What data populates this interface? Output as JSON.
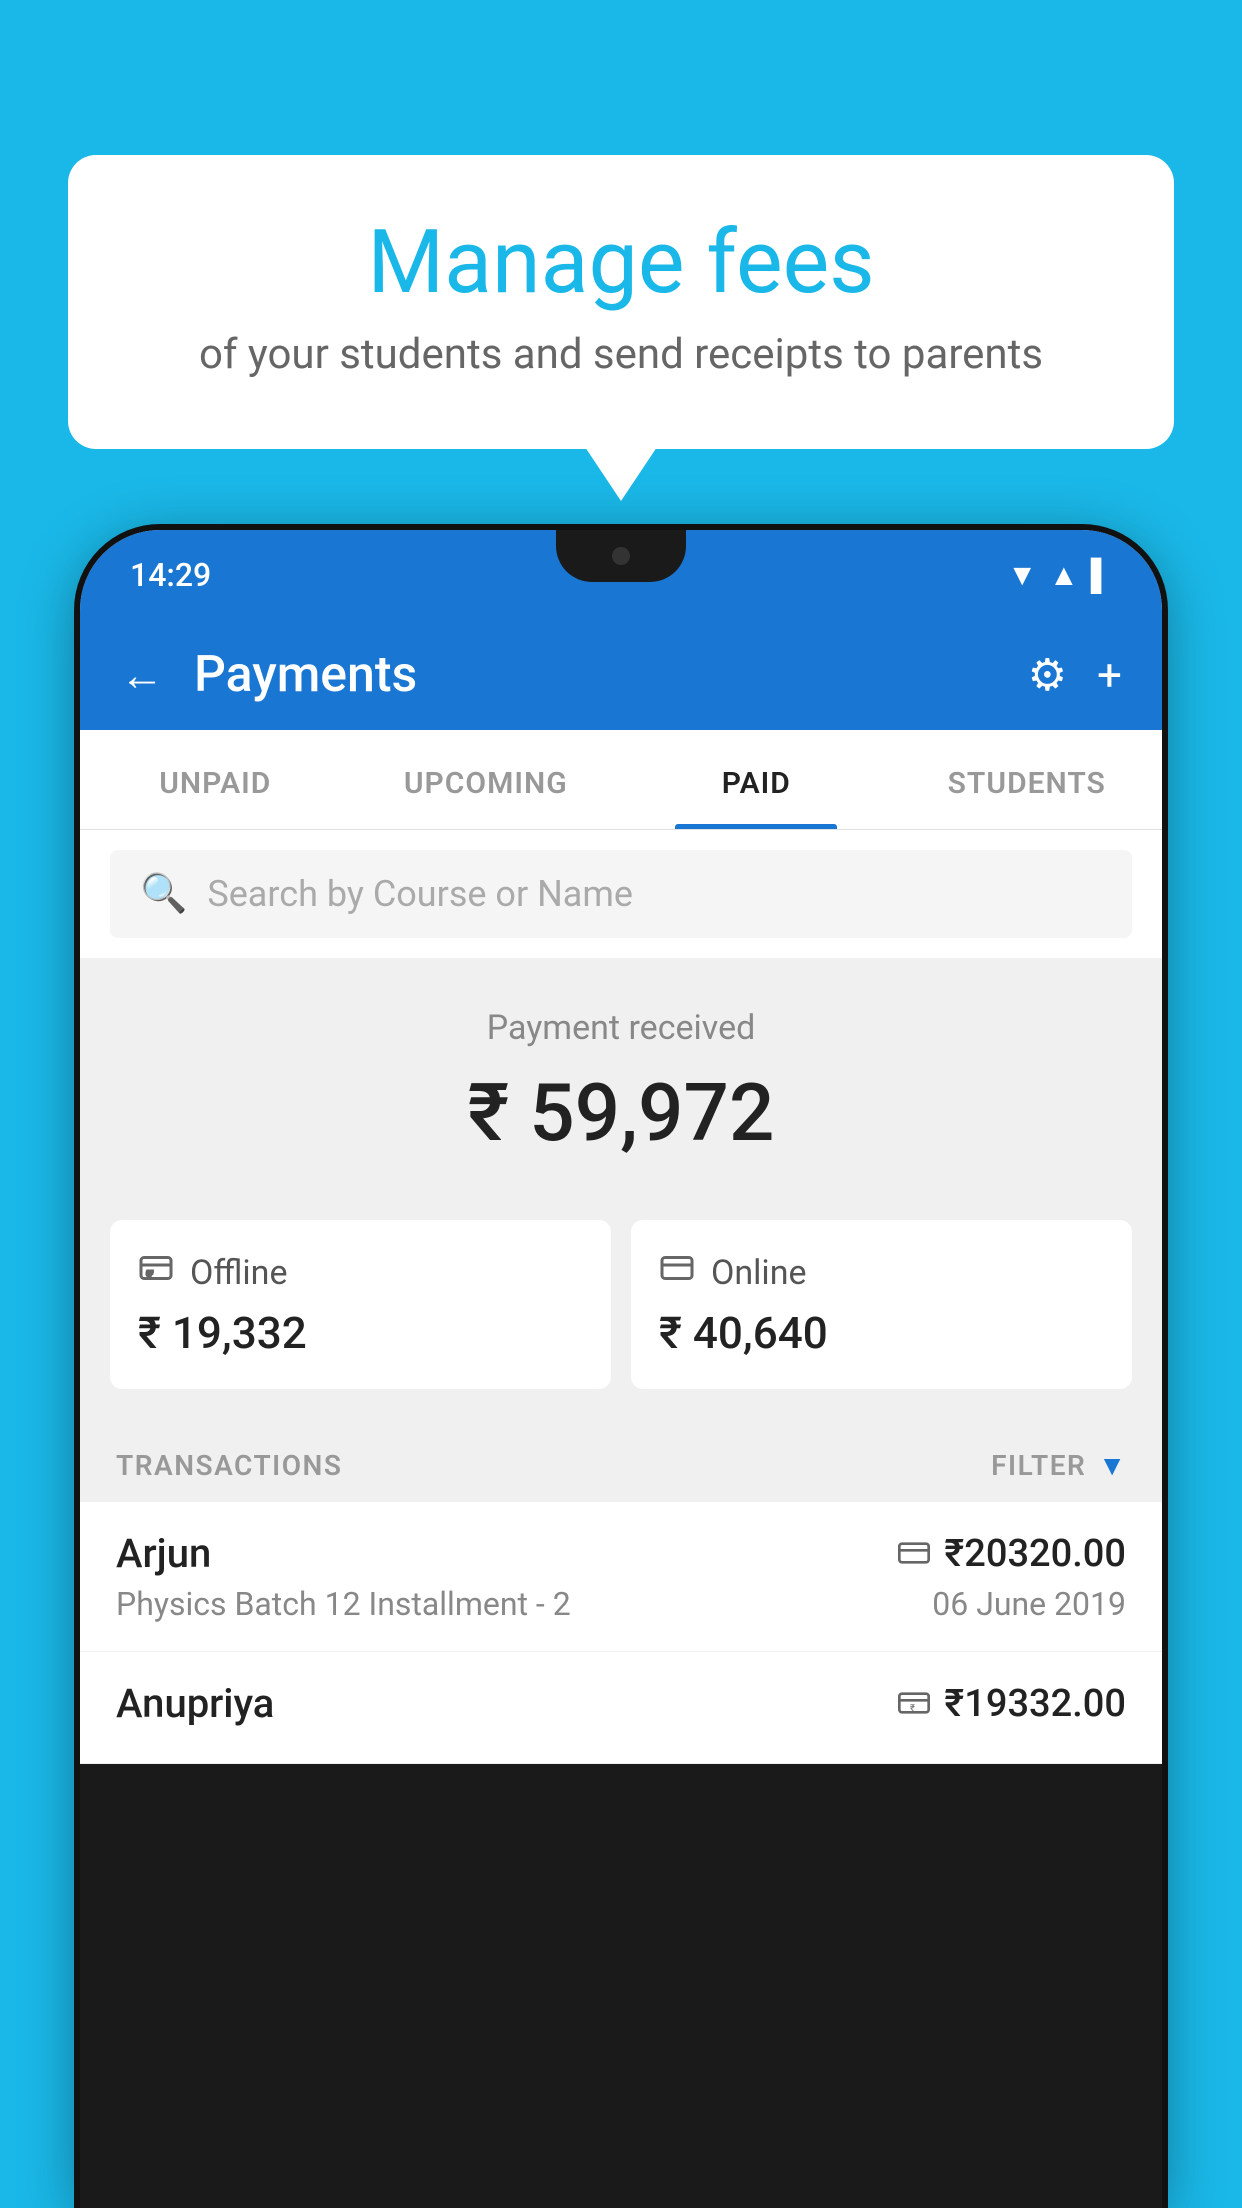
{
  "background_color": "#1ab8e8",
  "speech_bubble": {
    "title": "Manage fees",
    "subtitle": "of your students and send receipts to parents"
  },
  "phone": {
    "status_bar": {
      "time": "14:29",
      "icons": [
        "▼",
        "▲",
        "▌"
      ]
    },
    "header": {
      "title": "Payments",
      "back_label": "←",
      "settings_icon": "⚙",
      "add_icon": "+"
    },
    "tabs": [
      {
        "label": "UNPAID",
        "active": false
      },
      {
        "label": "UPCOMING",
        "active": false
      },
      {
        "label": "PAID",
        "active": true
      },
      {
        "label": "STUDENTS",
        "active": false
      }
    ],
    "search": {
      "placeholder": "Search by Course or Name"
    },
    "payment_received": {
      "label": "Payment received",
      "amount": "₹ 59,972",
      "offline": {
        "label": "Offline",
        "amount": "₹ 19,332",
        "icon": "₹"
      },
      "online": {
        "label": "Online",
        "amount": "₹ 40,640",
        "icon": "▬"
      }
    },
    "transactions": {
      "header_label": "TRANSACTIONS",
      "filter_label": "FILTER",
      "items": [
        {
          "name": "Arjun",
          "description": "Physics Batch 12 Installment - 2",
          "amount": "₹20320.00",
          "date": "06 June 2019",
          "payment_type": "online",
          "payment_icon": "▬"
        },
        {
          "name": "Anupriya",
          "description": "",
          "amount": "₹19332.00",
          "date": "",
          "payment_type": "offline",
          "payment_icon": "₹"
        }
      ]
    }
  }
}
